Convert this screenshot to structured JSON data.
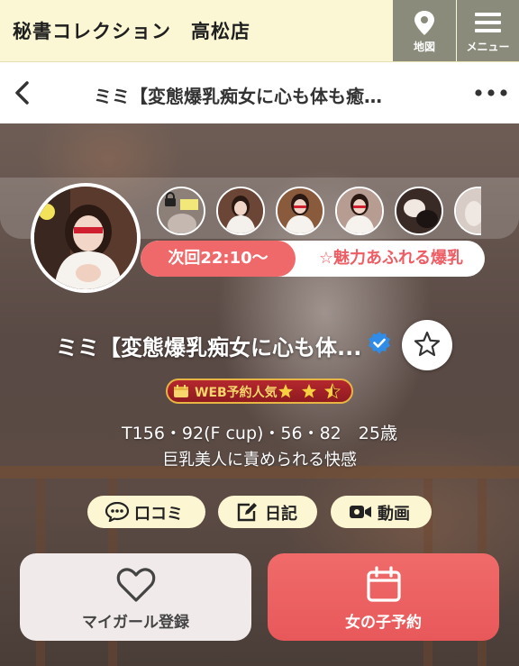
{
  "header": {
    "shop_name": "秘書コレクション　高松店",
    "map_label": "地図",
    "menu_label": "メニュー"
  },
  "titlebar": {
    "title": "ミミ【変態爆乳痴女に心も体も癒…"
  },
  "profile": {
    "next_time": "次回22:10〜",
    "catchphrase_tag": "☆魅力あふれる爆乳",
    "name": "ミミ【変態爆乳痴女に心も体...",
    "badge_label": "WEB予約人気",
    "badge_rating": 2.5,
    "specs": "T156・92(F cup)・56・82　25歳",
    "catchcopy": "巨乳美人に責められる快感"
  },
  "chips": [
    {
      "label": "口コミ",
      "icon": "chat-bubble-icon"
    },
    {
      "label": "日記",
      "icon": "edit-icon"
    },
    {
      "label": "動画",
      "icon": "video-camera-icon"
    }
  ],
  "actions": {
    "mygirl_label": "マイガール登録",
    "reserve_label": "女の子予約"
  },
  "colors": {
    "header_bg": "#fbf7d4",
    "header_button_bg": "#8b8b7b",
    "accent_red": "#f0696a",
    "chip_bg": "#fdf6d2",
    "badge_red": "#b5282e",
    "badge_gold": "#e8b545"
  }
}
